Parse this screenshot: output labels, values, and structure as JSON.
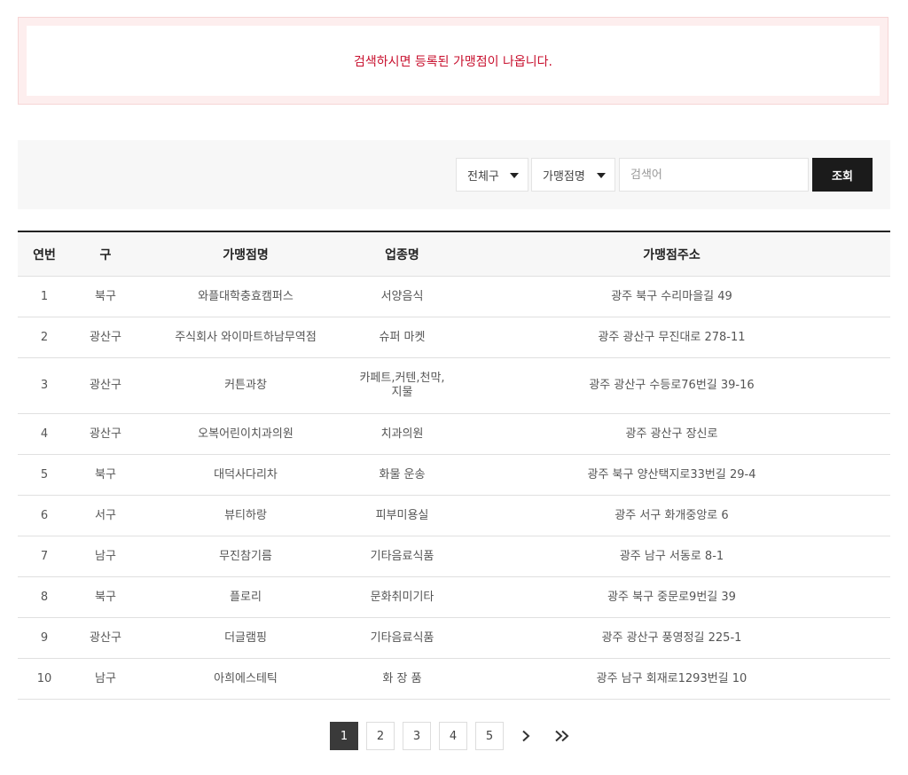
{
  "notice": {
    "message": "검색하시면 등록된 가맹점이 나옵니다."
  },
  "search": {
    "district_select": "전체구",
    "type_select": "가맹점명",
    "keyword_placeholder": "검색어",
    "submit_label": "조회"
  },
  "table": {
    "headers": {
      "no": "연번",
      "gu": "구",
      "name": "가맹점명",
      "category": "업종명",
      "address": "가맹점주소"
    },
    "rows": [
      {
        "no": "1",
        "gu": "북구",
        "name": "와플대학충효캠퍼스",
        "category": "서양음식",
        "address": "광주 북구 수리마을길 49"
      },
      {
        "no": "2",
        "gu": "광산구",
        "name": "주식회사 와이마트하남무역점",
        "category": "슈퍼 마켓",
        "address": "광주 광산구 무진대로 278-11"
      },
      {
        "no": "3",
        "gu": "광산구",
        "name": "커튼과창",
        "category": "카페트,커텐,천막,지물",
        "address": "광주 광산구 수등로76번길 39-16"
      },
      {
        "no": "4",
        "gu": "광산구",
        "name": "오복어린이치과의원",
        "category": "치과의원",
        "address": "광주 광산구 장신로"
      },
      {
        "no": "5",
        "gu": "북구",
        "name": "대덕사다리차",
        "category": "화물 운송",
        "address": "광주 북구 양산택지로33번길 29-4"
      },
      {
        "no": "6",
        "gu": "서구",
        "name": "뷰티하랑",
        "category": "피부미용실",
        "address": "광주 서구 화개중앙로 6"
      },
      {
        "no": "7",
        "gu": "남구",
        "name": "무진참기름",
        "category": "기타음료식품",
        "address": "광주 남구 서동로 8-1"
      },
      {
        "no": "8",
        "gu": "북구",
        "name": "플로리",
        "category": "문화취미기타",
        "address": "광주 북구 중문로9번길 39"
      },
      {
        "no": "9",
        "gu": "광산구",
        "name": "더글램핑",
        "category": "기타음료식품",
        "address": "광주 광산구 풍영정길 225-1"
      },
      {
        "no": "10",
        "gu": "남구",
        "name": "아희에스테틱",
        "category": "화 장 품",
        "address": "광주 남구 회재로1293번길 10"
      }
    ]
  },
  "pagination": {
    "pages": [
      "1",
      "2",
      "3",
      "4",
      "5"
    ],
    "current": "1",
    "icons": {
      "next": "chevron-right-icon",
      "last": "double-chevron-right-icon"
    }
  },
  "colors": {
    "notice_text": "#c8102e",
    "button_bg": "#1b1b1b",
    "active_page": "#3a3a3a"
  }
}
